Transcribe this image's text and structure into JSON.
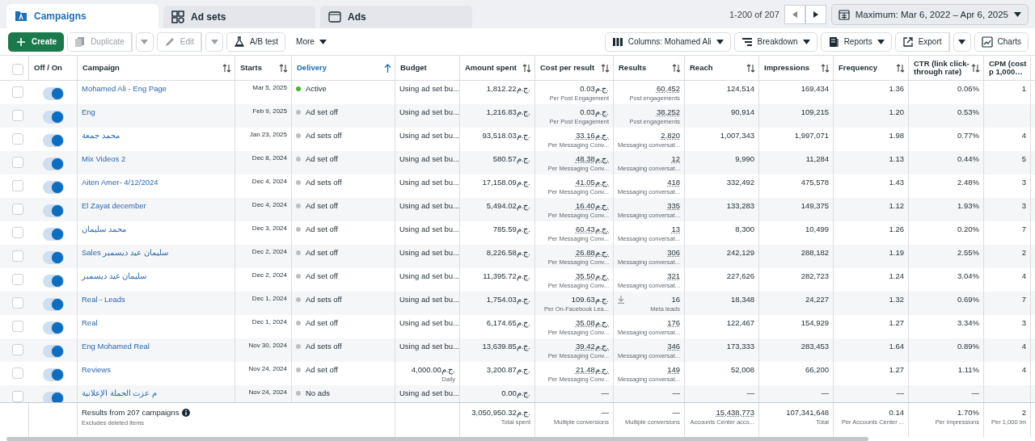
{
  "tabs": [
    {
      "label": "Campaigns",
      "selected": true
    },
    {
      "label": "Ad sets",
      "selected": false
    },
    {
      "label": "Ads",
      "selected": false
    }
  ],
  "pagination": {
    "range": "1-200 of 207"
  },
  "date_range": {
    "label": "Maximum: Mar 6, 2022 – Apr 6, 2025"
  },
  "toolbar_left": [
    {
      "label": "Create",
      "kind": "primary",
      "disabled": false,
      "split": false
    },
    {
      "label": "Duplicate",
      "kind": "plain",
      "disabled": true,
      "split": true
    },
    {
      "label": "Edit",
      "kind": "plain",
      "disabled": true,
      "split": true
    },
    {
      "label": "A/B test",
      "kind": "plain",
      "disabled": false,
      "split": false
    },
    {
      "label": "More",
      "kind": "menu",
      "disabled": false,
      "split": false
    }
  ],
  "toolbar_right": [
    {
      "label": "Columns: Mohamed Ali",
      "caret": true,
      "split": false
    },
    {
      "label": "Breakdown",
      "caret": true,
      "split": false
    },
    {
      "label": "Reports",
      "caret": true,
      "split": false
    },
    {
      "label": "Export",
      "caret": false,
      "split": true
    },
    {
      "label": "Charts",
      "caret": false,
      "split": false
    }
  ],
  "table": {
    "select_all": {
      "checked": false
    },
    "columns": [
      {
        "label": "Off / On",
        "sortable": false,
        "sorted": false
      },
      {
        "label": "Campaign",
        "sortable": true,
        "sorted": false
      },
      {
        "label": "Starts",
        "sortable": true,
        "sorted": false
      },
      {
        "label": "Delivery",
        "sortable": true,
        "sorted": true
      },
      {
        "label": "Budget",
        "sortable": false,
        "sorted": false
      },
      {
        "label": "Amount spent",
        "sortable": true,
        "sorted": false
      },
      {
        "label": "Cost per result",
        "sortable": true,
        "sorted": false
      },
      {
        "label": "Results",
        "sortable": true,
        "sorted": false
      },
      {
        "label": "Reach",
        "sortable": true,
        "sorted": false
      },
      {
        "label": "Impressions",
        "sortable": true,
        "sorted": false
      },
      {
        "label": "Frequency",
        "sortable": true,
        "sorted": false
      },
      {
        "label": "CTR (link click-through rate)",
        "sortable": true,
        "sorted": false
      },
      {
        "label": "CPM (cost p 1,000…",
        "sortable": false,
        "sorted": false
      }
    ],
    "rows": [
      {
        "checked": false,
        "on": true,
        "name": "Mohamed Ali - Eng Page",
        "starts": "Mar 5, 2025",
        "delivery": {
          "label": "Active",
          "color": "#42b72a"
        },
        "budget": {
          "value": "Using ad set bu..."
        },
        "spent": "1,812.22ج.م.",
        "cost": {
          "value": "0.03ج.م.",
          "note": "Per Post Engagement",
          "dotted": false
        },
        "results": {
          "value": "60,452",
          "note": "Post engagements",
          "dotted": true,
          "lead_icon": false
        },
        "reach": "124,514",
        "impressions": "169,434",
        "frequency": "1.36",
        "ctr": "0.06%",
        "cpm": "1"
      },
      {
        "checked": false,
        "on": true,
        "name": "Eng",
        "starts": "Feb 9, 2025",
        "delivery": {
          "label": "Ad set off",
          "color": "#bcc0c4"
        },
        "budget": {
          "value": "Using ad set bu..."
        },
        "spent": "1,216.83ج.م.",
        "cost": {
          "value": "0.03ج.م.",
          "note": "Per Post Engagement",
          "dotted": false
        },
        "results": {
          "value": "38,252",
          "note": "Post engagements",
          "dotted": true,
          "lead_icon": false
        },
        "reach": "90,914",
        "impressions": "109,215",
        "frequency": "1.20",
        "ctr": "0.53%"
      },
      {
        "checked": false,
        "on": true,
        "name": "محمد جمعة",
        "starts": "Jan 23, 2025",
        "delivery": {
          "label": "Ad sets off",
          "color": "#bcc0c4"
        },
        "budget": {
          "value": "Using ad set bu..."
        },
        "spent": "93,518.03ج.م.",
        "cost": {
          "value": "33.16ج.م.",
          "note": "Per Messaging Conv...",
          "dotted": true
        },
        "results": {
          "value": "2,820",
          "note": "Messaging conversat...",
          "dotted": true,
          "lead_icon": false
        },
        "reach": "1,007,343",
        "impressions": "1,997,071",
        "frequency": "1.98",
        "ctr": "0.77%",
        "cpm": "4"
      },
      {
        "checked": false,
        "on": true,
        "name": "Mix Videos 2",
        "starts": "Dec 8, 2024",
        "delivery": {
          "label": "Ad set off",
          "color": "#bcc0c4"
        },
        "budget": {
          "value": "Using ad set bu..."
        },
        "spent": "580.57ج.م.",
        "cost": {
          "value": "48.38ج.م.",
          "note": "Per Messaging Conv...",
          "dotted": true
        },
        "results": {
          "value": "12",
          "note": "Messaging conversat...",
          "dotted": true,
          "lead_icon": false
        },
        "reach": "9,990",
        "impressions": "11,284",
        "frequency": "1.13",
        "ctr": "0.44%",
        "cpm": "5"
      },
      {
        "checked": false,
        "on": true,
        "name": "Aiten Amer- 4/12/2024",
        "starts": "Dec 4, 2024",
        "delivery": {
          "label": "Ad sets off",
          "color": "#bcc0c4"
        },
        "budget": {
          "value": "Using ad set bu..."
        },
        "spent": "17,158.09ج.م.",
        "cost": {
          "value": "41.05ج.م.",
          "note": "Per Messaging Conv...",
          "dotted": true
        },
        "results": {
          "value": "418",
          "note": "Messaging conversat...",
          "dotted": true,
          "lead_icon": false
        },
        "reach": "332,492",
        "impressions": "475,578",
        "frequency": "1.43",
        "ctr": "2.48%",
        "cpm": "3"
      },
      {
        "checked": false,
        "on": true,
        "name": "El Zayat december",
        "starts": "Dec 4, 2024",
        "delivery": {
          "label": "Ad set off",
          "color": "#bcc0c4"
        },
        "budget": {
          "value": "Using ad set bu..."
        },
        "spent": "5,494.02ج.م.",
        "cost": {
          "value": "16.40ج.م.",
          "note": "Per Messaging Conv...",
          "dotted": true
        },
        "results": {
          "value": "335",
          "note": "Messaging conversat...",
          "dotted": true,
          "lead_icon": false
        },
        "reach": "133,283",
        "impressions": "149,375",
        "frequency": "1.12",
        "ctr": "1.93%",
        "cpm": "3"
      },
      {
        "checked": false,
        "on": true,
        "name": "محمد سليمان",
        "starts": "Dec 3, 2024",
        "delivery": {
          "label": "Ad set off",
          "color": "#bcc0c4"
        },
        "budget": {
          "value": "Using ad set bu..."
        },
        "spent": "785.59ج.م.",
        "cost": {
          "value": "60.43ج.م.",
          "note": "Per Messaging Conv...",
          "dotted": true
        },
        "results": {
          "value": "13",
          "note": "Messaging conversat...",
          "dotted": true,
          "lead_icon": false
        },
        "reach": "8,300",
        "impressions": "10,499",
        "frequency": "1.26",
        "ctr": "0.20%",
        "cpm": "7"
      },
      {
        "checked": false,
        "on": true,
        "name": "Sales سليمان عيد ديسمبر",
        "starts": "Dec 2, 2024",
        "delivery": {
          "label": "Ad set off",
          "color": "#bcc0c4"
        },
        "budget": {
          "value": "Using ad set bu..."
        },
        "spent": "8,226.58ج.م.",
        "cost": {
          "value": "26.88ج.م.",
          "note": "Per Messaging Conv...",
          "dotted": true
        },
        "results": {
          "value": "306",
          "note": "Messaging conversat...",
          "dotted": true,
          "lead_icon": false
        },
        "reach": "242,129",
        "impressions": "288,182",
        "frequency": "1.19",
        "ctr": "2.55%",
        "cpm": "2"
      },
      {
        "checked": false,
        "on": true,
        "name": "سليمان عيد ديسمبر",
        "starts": "Dec 2, 2024",
        "delivery": {
          "label": "Ad set off",
          "color": "#bcc0c4"
        },
        "budget": {
          "value": "Using ad set bu..."
        },
        "spent": "11,395.72ج.م.",
        "cost": {
          "value": "35.50ج.م.",
          "note": "Per Messaging Conv...",
          "dotted": true
        },
        "results": {
          "value": "321",
          "note": "Messaging conversat...",
          "dotted": true,
          "lead_icon": false
        },
        "reach": "227,626",
        "impressions": "282,723",
        "frequency": "1.24",
        "ctr": "3.04%",
        "cpm": "4"
      },
      {
        "checked": false,
        "on": true,
        "name": "Real - Leads",
        "starts": "Dec 1, 2024",
        "delivery": {
          "label": "Ad sets off",
          "color": "#bcc0c4"
        },
        "budget": {
          "value": "Using ad set bu..."
        },
        "spent": "1,754.03ج.م.",
        "cost": {
          "value": "109.63ج.م.",
          "note": "Per On-Facebook Lea...",
          "dotted": false
        },
        "results": {
          "value": "16",
          "note": "Meta leads",
          "dotted": false,
          "lead_icon": true
        },
        "reach": "18,348",
        "impressions": "24,227",
        "frequency": "1.32",
        "ctr": "0.69%",
        "cpm": "7"
      },
      {
        "checked": false,
        "on": true,
        "name": "Real",
        "starts": "Dec 1, 2024",
        "delivery": {
          "label": "Ad set off",
          "color": "#bcc0c4"
        },
        "budget": {
          "value": "Using ad set bu..."
        },
        "spent": "6,174.65ج.م.",
        "cost": {
          "value": "35.08ج.م.",
          "note": "Per Messaging Conv...",
          "dotted": true
        },
        "results": {
          "value": "176",
          "note": "Messaging conversat...",
          "dotted": true,
          "lead_icon": false
        },
        "reach": "122,467",
        "impressions": "154,929",
        "frequency": "1.27",
        "ctr": "3.34%",
        "cpm": "3"
      },
      {
        "checked": false,
        "on": true,
        "name": "Eng Mohamed Real",
        "starts": "Nov 30, 2024",
        "delivery": {
          "label": "Ad sets off",
          "color": "#bcc0c4"
        },
        "budget": {
          "value": "Using ad set bu..."
        },
        "spent": "13,639.85ج.م.",
        "cost": {
          "value": "39.42ج.م.",
          "note": "Per Messaging Conv...",
          "dotted": true
        },
        "results": {
          "value": "346",
          "note": "Messaging conversat...",
          "dotted": true,
          "lead_icon": false
        },
        "reach": "173,333",
        "impressions": "283,453",
        "frequency": "1.64",
        "ctr": "0.89%",
        "cpm": "4"
      },
      {
        "checked": false,
        "on": true,
        "name": "Reviews",
        "starts": "Nov 24, 2024",
        "delivery": {
          "label": "Ad set off",
          "color": "#bcc0c4"
        },
        "budget": {
          "value": "4,000.00ج.م.",
          "note": "Daily"
        },
        "spent": "3,200.87ج.م.",
        "cost": {
          "value": "21.48ج.م.",
          "note": "Per Messaging Conv...",
          "dotted": true
        },
        "results": {
          "value": "149",
          "note": "Messaging conversat...",
          "dotted": true,
          "lead_icon": false
        },
        "reach": "52,008",
        "impressions": "66,200",
        "frequency": "1.27",
        "ctr": "1.11%",
        "cpm": "4"
      },
      {
        "checked": false,
        "on": true,
        "name": "م عزت الحملة الإعلانية",
        "starts": "Nov 24, 2024",
        "delivery": {
          "label": "No ads",
          "color": "#bcc0c4"
        },
        "budget": {
          "value": "Using ad set bu..."
        },
        "spent": "0.00ج.م.",
        "cost": {
          "value": "—",
          "dotted": false
        },
        "results": {
          "value": "—",
          "dotted": false
        },
        "reach": "—",
        "impressions": "—",
        "frequency": "—",
        "ctr": "—"
      }
    ],
    "footer": {
      "title": "Results from 207 campaigns",
      "subtitle": "Excludes deleted items",
      "cells": [
        {
          "value": "3,050,950.32ج.م.",
          "note": "Total spent",
          "dotted": false
        },
        {
          "value": "—",
          "note": "Multiple conversions",
          "dotted": false
        },
        {
          "value": "—",
          "note": "Multiple conversions",
          "dotted": false
        },
        {
          "value": "15,438,773",
          "note": "Accounts Center acco...",
          "dotted": true
        },
        {
          "value": "107,341,648",
          "note": "Total",
          "dotted": false
        },
        {
          "value": "0.14",
          "note": "Per Accounts Center ...",
          "dotted": false
        },
        {
          "value": "1.70%",
          "note": "Per Impressions",
          "dotted": false
        },
        {
          "value": "2",
          "note": "Per 1,000 Im",
          "dotted": false
        }
      ]
    }
  }
}
